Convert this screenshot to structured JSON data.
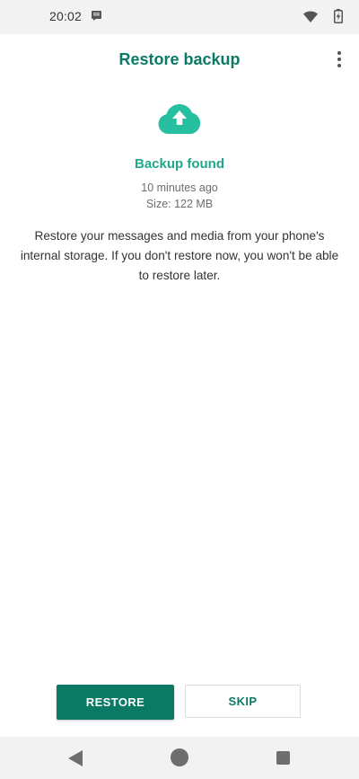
{
  "status_bar": {
    "time": "20:02",
    "notification_icon": "message-icon",
    "wifi_icon": "wifi-icon",
    "battery_icon": "battery-charging-icon"
  },
  "app_bar": {
    "title": "Restore backup",
    "menu_icon": "more-vert-icon"
  },
  "backup": {
    "icon": "cloud-upload-icon",
    "status": "Backup found",
    "time": "10 minutes ago",
    "size": "Size: 122 MB",
    "description": "Restore your messages and media from your phone's internal storage. If you don't restore now, you won't be able to restore later."
  },
  "actions": {
    "restore_label": "RESTORE",
    "skip_label": "SKIP"
  },
  "nav_bar": {
    "back_icon": "back-icon",
    "home_icon": "home-icon",
    "recents_icon": "recents-icon"
  },
  "colors": {
    "primary": "#0b7a64",
    "accent": "#1fa88a",
    "cloud": "#26c0a0"
  }
}
